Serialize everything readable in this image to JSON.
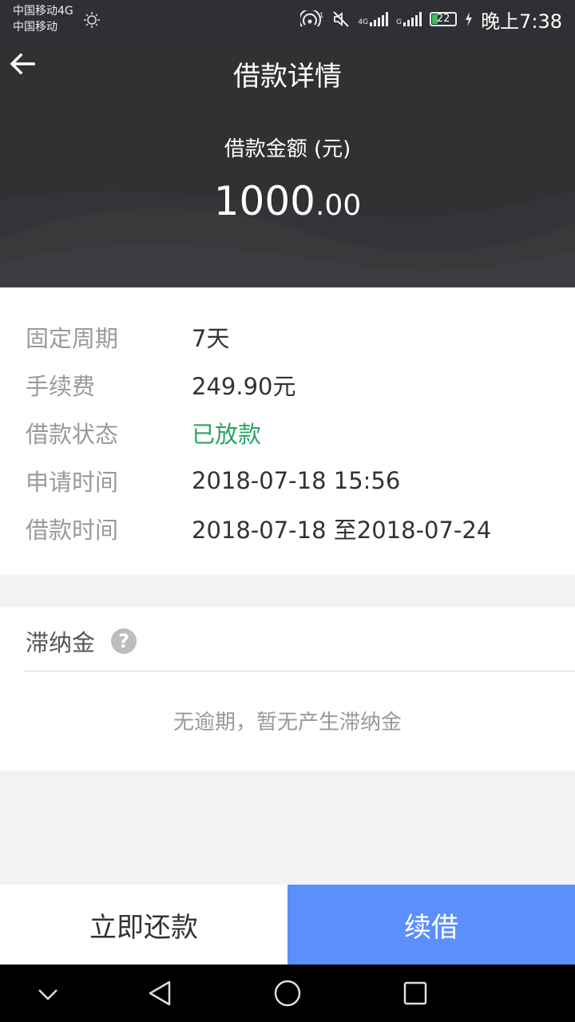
{
  "status_bar": {
    "carrier_line1": "中国移动4G",
    "carrier_line2": "中国移动",
    "net1": "4G",
    "net2": "G",
    "battery": "22",
    "battery_level": 0.22,
    "time": "晚上7:38",
    "icons": [
      "brightness-icon",
      "hotspot-icon",
      "mute-icon",
      "signal-icon",
      "battery-icon",
      "charging-icon"
    ]
  },
  "header": {
    "title": "借款详情",
    "amount_label": "借款金额 (元)",
    "amount_int": "1000",
    "amount_dec": ".00"
  },
  "details": [
    {
      "key": "固定周期",
      "value": "7天"
    },
    {
      "key": "手续费",
      "value": "249.90元"
    },
    {
      "key": "借款状态",
      "value": "已放款"
    },
    {
      "key": "申请时间",
      "value": "2018-07-18 15:56"
    },
    {
      "key": "借款时间",
      "value": "2018-07-18 至2018-07-24"
    }
  ],
  "late_fee": {
    "title": "滞纳金",
    "help_icon": "?",
    "message": "无逾期，暂无产生滞纳金"
  },
  "actions": {
    "repay": "立即还款",
    "renew": "续借"
  },
  "colors": {
    "header_bg": "#2f3133",
    "status_green": "#2aa466",
    "accent_blue": "#5b8ff9"
  },
  "nav_icons": [
    "chevron-down-icon",
    "back-triangle-icon",
    "home-circle-icon",
    "recents-square-icon"
  ]
}
